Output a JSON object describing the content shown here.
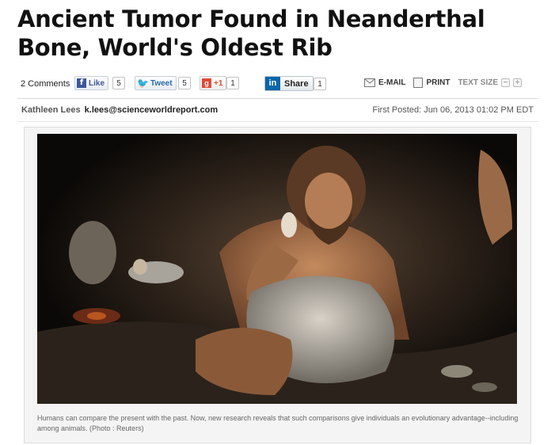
{
  "article": {
    "title": "Ancient Tumor Found in Neanderthal Bone, World's Oldest Rib",
    "author": "Kathleen Lees",
    "author_email": "k.lees@scienceworldreport.com",
    "posted": "First Posted: Jun 06, 2013 01:02 PM EDT"
  },
  "share": {
    "comments": "2 Comments",
    "facebook_label": "Like",
    "facebook_count": "5",
    "twitter_label": "Tweet",
    "twitter_count": "5",
    "gplus_label": "+1",
    "gplus_count": "1",
    "linkedin_label": "Share",
    "linkedin_count": "1",
    "email_label": "E-MAIL",
    "print_label": "PRINT",
    "textsize_label": "TEXT SIZE"
  },
  "figure": {
    "caption": "Humans can compare the present with the past. Now, new research reveals that such comparisons give individuals an evolutionary advantage--including among animals. (Photo : Reuters)"
  },
  "icons": {
    "facebook": "facebook-icon",
    "twitter": "twitter-icon",
    "gplus": "google-plus-icon",
    "linkedin": "linkedin-icon",
    "email": "email-icon",
    "print": "print-icon",
    "decrease": "minus-icon",
    "increase": "plus-icon"
  }
}
